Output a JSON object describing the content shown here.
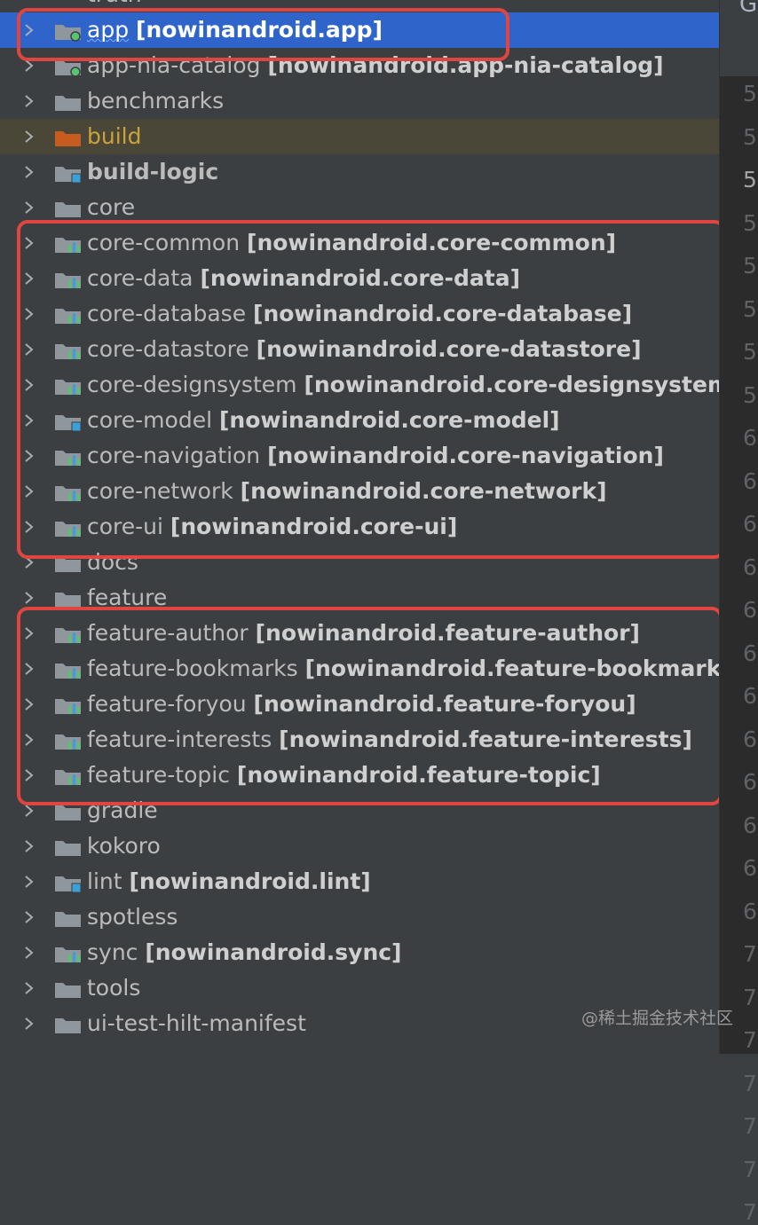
{
  "partial_top_label": "truth",
  "rows": [
    {
      "name": "app",
      "module": "[nowinandroid.app]",
      "icon": "app",
      "selected": true
    },
    {
      "name": "app-nia-catalog",
      "module": "[nowinandroid.app-nia-catalog]",
      "icon": "app"
    },
    {
      "name": "benchmarks",
      "module": "",
      "icon": "folder"
    },
    {
      "name": "build",
      "module": "",
      "icon": "excluded",
      "excluded": true
    },
    {
      "name": "build-logic",
      "module": "",
      "icon": "module-blue",
      "bold": true
    },
    {
      "name": "core",
      "module": "",
      "icon": "folder"
    },
    {
      "name": "core-common",
      "module": "[nowinandroid.core-common]",
      "icon": "lib"
    },
    {
      "name": "core-data",
      "module": "[nowinandroid.core-data]",
      "icon": "lib"
    },
    {
      "name": "core-database",
      "module": "[nowinandroid.core-database]",
      "icon": "lib"
    },
    {
      "name": "core-datastore",
      "module": "[nowinandroid.core-datastore]",
      "icon": "lib"
    },
    {
      "name": "core-designsystem",
      "module": "[nowinandroid.core-designsystem]",
      "icon": "lib"
    },
    {
      "name": "core-model",
      "module": "[nowinandroid.core-model]",
      "icon": "module-blue"
    },
    {
      "name": "core-navigation",
      "module": "[nowinandroid.core-navigation]",
      "icon": "lib"
    },
    {
      "name": "core-network",
      "module": "[nowinandroid.core-network]",
      "icon": "lib"
    },
    {
      "name": "core-ui",
      "module": "[nowinandroid.core-ui]",
      "icon": "lib"
    },
    {
      "name": "docs",
      "module": "",
      "icon": "folder"
    },
    {
      "name": "feature",
      "module": "",
      "icon": "folder"
    },
    {
      "name": "feature-author",
      "module": "[nowinandroid.feature-author]",
      "icon": "lib"
    },
    {
      "name": "feature-bookmarks",
      "module": "[nowinandroid.feature-bookmarks]",
      "icon": "lib"
    },
    {
      "name": "feature-foryou",
      "module": "[nowinandroid.feature-foryou]",
      "icon": "lib"
    },
    {
      "name": "feature-interests",
      "module": "[nowinandroid.feature-interests]",
      "icon": "lib"
    },
    {
      "name": "feature-topic",
      "module": "[nowinandroid.feature-topic]",
      "icon": "lib"
    },
    {
      "name": "gradle",
      "module": "",
      "icon": "folder"
    },
    {
      "name": "kokoro",
      "module": "",
      "icon": "folder"
    },
    {
      "name": "lint",
      "module": "[nowinandroid.lint]",
      "icon": "module-blue"
    },
    {
      "name": "spotless",
      "module": "",
      "icon": "folder"
    },
    {
      "name": "sync",
      "module": "[nowinandroid.sync]",
      "icon": "lib"
    },
    {
      "name": "tools",
      "module": "",
      "icon": "folder"
    },
    {
      "name": "ui-test-hilt-manifest",
      "module": "",
      "icon": "folder"
    }
  ],
  "gutter": {
    "tab_letter": "G",
    "line_numbers": [
      "5",
      "5",
      "5",
      "5",
      "5",
      "5",
      "5",
      "5",
      "6",
      "6",
      "6",
      "6",
      "6",
      "6",
      "6",
      "6",
      "6",
      "6",
      "6",
      "6",
      "7",
      "7",
      "7",
      "7",
      "7",
      "7",
      "7"
    ]
  },
  "watermark": "@稀土掘金技术社区",
  "colors": {
    "selection": "#2f65ca",
    "highlight_box": "#e0453f",
    "panel_bg": "#3c3f41",
    "excluded_folder": "#c65d1e",
    "module_accent_blue": "#3aa0d8",
    "app_dot_green": "#57c470"
  }
}
